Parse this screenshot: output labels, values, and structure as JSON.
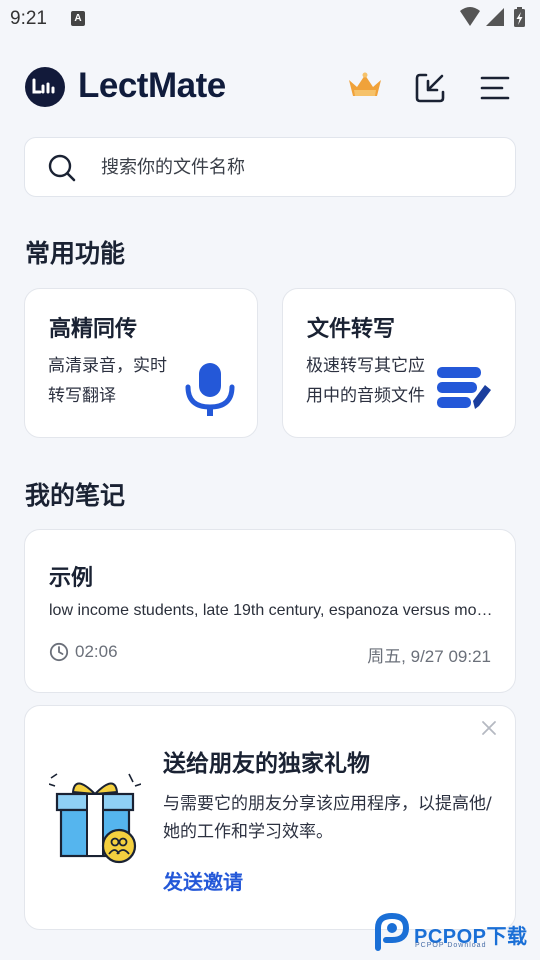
{
  "status_bar": {
    "time": "9:21",
    "notification_letter": "A",
    "icons": [
      "wifi-icon",
      "signal-icon",
      "battery-charging-icon"
    ]
  },
  "app_bar": {
    "brand_name": "LectMate",
    "icons": [
      "crown-icon",
      "download-icon",
      "menu-icon"
    ]
  },
  "search": {
    "placeholder": "搜索你的文件名称"
  },
  "features_section": {
    "title": "常用功能",
    "items": [
      {
        "title": "高精同传",
        "description": "高清录音，实时转写翻译",
        "icon": "microphone-icon"
      },
      {
        "title": "文件转写",
        "description": "极速转写其它应用中的音频文件",
        "icon": "document-edit-icon"
      }
    ]
  },
  "notes_section": {
    "title": "我的笔记",
    "notes": [
      {
        "title": "示例",
        "preview": "low income students, late 19th century, espanoza versus montana",
        "duration": "02:06",
        "date": "周五, 9/27 09:21"
      }
    ]
  },
  "gift_card": {
    "title": "送给朋友的独家礼物",
    "description": "与需要它的朋友分享该应用程序，以提高他/她的工作和学习效率。",
    "action_label": "发送邀请",
    "close_icon": "close-icon"
  },
  "watermark": {
    "text": "PCPOP下载",
    "subtext": "PCPOP Download"
  },
  "colors": {
    "background": "#f4f6fa",
    "accent": "#2458d8",
    "brand_dark": "#101c3c",
    "crown": "#f0a23a"
  }
}
